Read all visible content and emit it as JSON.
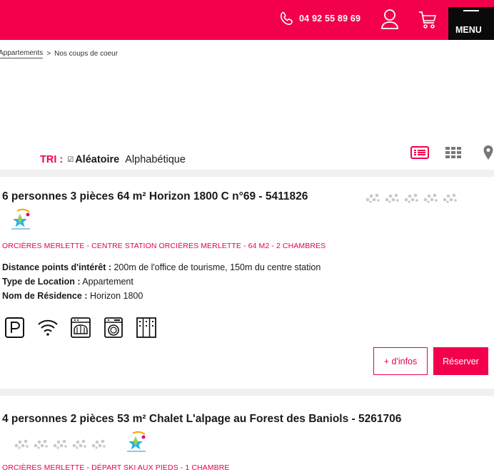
{
  "header": {
    "phone": "04 92 55 89 69",
    "menu_label": "MENU",
    "brand_color": "#f2004c"
  },
  "breadcrumb": {
    "items": [
      "Appartements",
      "Nos coups de coeur"
    ],
    "separator": ">"
  },
  "sort": {
    "label": "TRI :",
    "active": "Aléatoire",
    "alternate": "Alphabétique"
  },
  "view_icons": [
    "list-view-icon",
    "grid-view-icon",
    "map-pin-icon"
  ],
  "listings": [
    {
      "title": "6 personnes 3 pièces 64 m² Horizon 1800 C n°69 - 5411826",
      "rating_icons": 5,
      "location": "ORCIÈRES MERLETTE - CENTRE STATION ORCIÈRES MERLETTE - 64 M2 - 2 CHAMBRES",
      "details": [
        {
          "label": "Distance points d'intérêt :",
          "value": " 200m de l'office de tourisme,  150m du centre station"
        },
        {
          "label": "Type de Location :",
          "value": " Appartement"
        },
        {
          "label": "Nom de Résidence :",
          "value": " Horizon 1800"
        }
      ],
      "amenities": [
        "parking-icon",
        "wifi-icon",
        "dishwasher-icon",
        "washing-machine-icon",
        "ski-locker-icon"
      ],
      "buttons": {
        "info": "+ d'infos",
        "book": "Réserver"
      }
    },
    {
      "title": "4 personnes 2 pièces 53 m² Chalet L'alpage au Forest des Baniols - 5261706",
      "rating_icons": 5,
      "location": "ORCIÈRES MERLETTE - DÉPART SKI AUX PIEDS - 1 CHAMBRE"
    }
  ]
}
